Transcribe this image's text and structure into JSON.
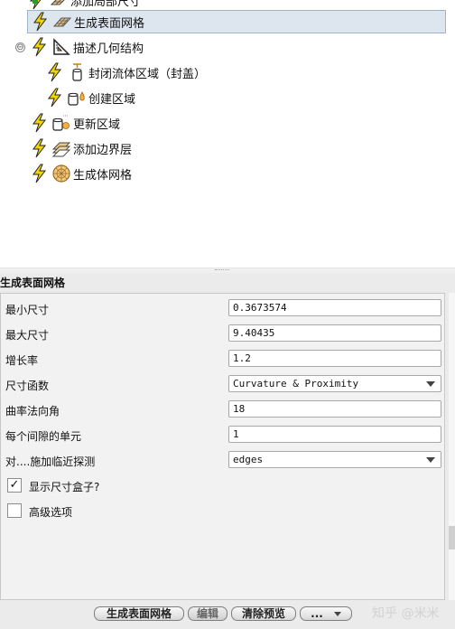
{
  "tree": {
    "nodes": [
      {
        "label": "添加局部尺寸",
        "state": "partial"
      },
      {
        "label": "生成表面网格",
        "selected": true
      },
      {
        "label": "描述几何结构",
        "expander": "⊖"
      },
      {
        "label": "封闭流体区域（封盖）"
      },
      {
        "label": "创建区域"
      },
      {
        "label": "更新区域"
      },
      {
        "label": "添加边界层"
      },
      {
        "label": "生成体网格"
      }
    ]
  },
  "props": {
    "title": "生成表面网格",
    "rows": [
      {
        "name": "最小尺寸",
        "value": "0.3673574"
      },
      {
        "name": "最大尺寸",
        "value": "9.40435"
      },
      {
        "name": "增长率",
        "value": "1.2"
      },
      {
        "name": "尺寸函数",
        "value": "Curvature & Proximity",
        "combo": true
      },
      {
        "name": "曲率法向角",
        "value": "18"
      },
      {
        "name": "每个间隙的单元",
        "value": "1"
      },
      {
        "name": "对....施加临近探测",
        "value": "edges",
        "combo": true
      }
    ],
    "checkboxes": [
      {
        "label": "显示尺寸盒子?",
        "checked": true,
        "mark": "✓"
      },
      {
        "label": "高级选项",
        "checked": false,
        "mark": ""
      }
    ]
  },
  "buttons": {
    "generate": "生成表面网格",
    "edit": "编辑",
    "clear": "清除预览",
    "more": "..."
  },
  "watermark": "知乎 @米米",
  "colors": {
    "lightning": "#f2d400",
    "selection": "#dde6ee",
    "panel": "#ebebeb"
  }
}
